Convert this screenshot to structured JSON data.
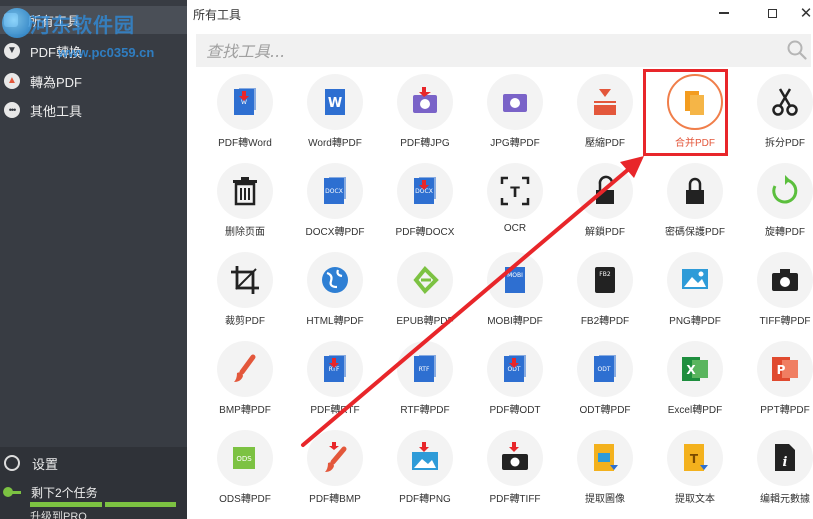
{
  "window": {
    "title": "所有工具"
  },
  "sidebar": {
    "items": [
      {
        "label": "所有工具",
        "icon": "grid-icon"
      },
      {
        "label": "PDF轉換",
        "icon": "download-icon"
      },
      {
        "label": "轉為PDF",
        "icon": "upload-icon"
      },
      {
        "label": "其他工具",
        "icon": "more-icon"
      }
    ],
    "settings_label": "设置",
    "tasks_label": "剩下2个任务",
    "upgrade_label": "升级到PRO"
  },
  "watermark": {
    "title": "河东软件园",
    "url": "www.pc0359.cn"
  },
  "search": {
    "placeholder": "查找工具..."
  },
  "tools": [
    {
      "label": "PDF轉Word",
      "icon": "pdf-to-word-icon"
    },
    {
      "label": "Word轉PDF",
      "icon": "word-to-pdf-icon"
    },
    {
      "label": "PDF轉JPG",
      "icon": "pdf-to-jpg-icon"
    },
    {
      "label": "JPG轉PDF",
      "icon": "jpg-to-pdf-icon"
    },
    {
      "label": "壓縮PDF",
      "icon": "compress-pdf-icon"
    },
    {
      "label": "合并PDF",
      "icon": "merge-pdf-icon",
      "highlighted": true
    },
    {
      "label": "拆分PDF",
      "icon": "scissors-icon"
    },
    {
      "label": "删除页面",
      "icon": "trash-icon"
    },
    {
      "label": "DOCX轉PDF",
      "icon": "docx-to-pdf-icon"
    },
    {
      "label": "PDF轉DOCX",
      "icon": "pdf-to-docx-icon"
    },
    {
      "label": "OCR",
      "icon": "ocr-icon"
    },
    {
      "label": "解鎖PDF",
      "icon": "unlock-icon"
    },
    {
      "label": "密碼保護PDF",
      "icon": "lock-icon"
    },
    {
      "label": "旋轉PDF",
      "icon": "rotate-icon"
    },
    {
      "label": "裁剪PDF",
      "icon": "crop-icon"
    },
    {
      "label": "HTML轉PDF",
      "icon": "html-globe-icon"
    },
    {
      "label": "EPUB轉PDF",
      "icon": "epub-icon"
    },
    {
      "label": "MOBI轉PDF",
      "icon": "mobi-icon"
    },
    {
      "label": "FB2轉PDF",
      "icon": "fb2-icon"
    },
    {
      "label": "PNG轉PDF",
      "icon": "png-image-icon"
    },
    {
      "label": "TIFF轉PDF",
      "icon": "camera-icon"
    },
    {
      "label": "BMP轉PDF",
      "icon": "brush-icon"
    },
    {
      "label": "PDF轉RTF",
      "icon": "pdf-to-rtf-icon"
    },
    {
      "label": "RTF轉PDF",
      "icon": "rtf-to-pdf-icon"
    },
    {
      "label": "PDF轉ODT",
      "icon": "pdf-to-odt-icon"
    },
    {
      "label": "ODT轉PDF",
      "icon": "odt-to-pdf-icon"
    },
    {
      "label": "Excel轉PDF",
      "icon": "excel-icon"
    },
    {
      "label": "PPT轉PDF",
      "icon": "ppt-icon"
    },
    {
      "label": "ODS轉PDF",
      "icon": "ods-icon"
    },
    {
      "label": "PDF轉BMP",
      "icon": "pdf-to-bmp-icon"
    },
    {
      "label": "PDF轉PNG",
      "icon": "pdf-to-png-icon"
    },
    {
      "label": "PDF轉TIFF",
      "icon": "pdf-to-tiff-icon"
    },
    {
      "label": "提取圖像",
      "icon": "extract-image-icon"
    },
    {
      "label": "提取文本",
      "icon": "extract-text-icon"
    },
    {
      "label": "编輯元數據",
      "icon": "metadata-icon"
    }
  ],
  "colors": {
    "sidebar_bg": "#383c43",
    "highlight_red": "#e8262a",
    "accent_orange": "#f07e4a",
    "progress_green": "#7cc242"
  }
}
